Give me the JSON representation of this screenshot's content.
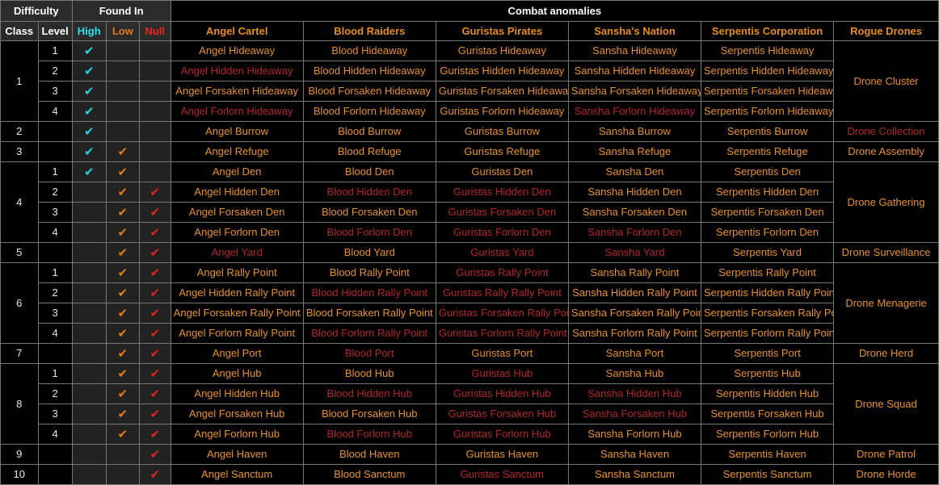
{
  "table": {
    "group_headers": [
      {
        "label": "Difficulty",
        "span": 2
      },
      {
        "label": "Found In",
        "span": 3
      },
      {
        "label": "Combat anomalies",
        "span": 6
      }
    ],
    "columns": [
      {
        "key": "class",
        "label": "Class"
      },
      {
        "key": "level",
        "label": "Level"
      },
      {
        "key": "high",
        "label": "High"
      },
      {
        "key": "low",
        "label": "Low"
      },
      {
        "key": "null",
        "label": "Null"
      },
      {
        "key": "angel",
        "label": "Angel Cartel"
      },
      {
        "key": "blood",
        "label": "Blood Raiders"
      },
      {
        "key": "guristas",
        "label": "Guristas Pirates"
      },
      {
        "key": "sansha",
        "label": "Sansha's Nation"
      },
      {
        "key": "serpentis",
        "label": "Serpentis Corporation"
      },
      {
        "key": "drones",
        "label": "Rogue Drones"
      }
    ],
    "check_glyph": "✔",
    "colors": {
      "high": "#25e6ec",
      "low": "#e07b19",
      "null": "#e8281c",
      "faction_header": "#e88e17",
      "text_orange": "#e8912a",
      "text_red": "#b4252a",
      "header_bg": "#2b2b2b",
      "cell_bg": "#000000",
      "foundin_bg": "#222222",
      "border": "#777777"
    },
    "rows": [
      {
        "class": "1",
        "class_span": 4,
        "level": "1",
        "high": true,
        "low": false,
        "null": false,
        "angel": {
          "t": "Angel Hideaway",
          "c": "o"
        },
        "blood": {
          "t": "Blood Hideaway",
          "c": "o"
        },
        "guristas": {
          "t": "Guristas Hideaway",
          "c": "o"
        },
        "sansha": {
          "t": "Sansha Hideaway",
          "c": "o"
        },
        "serpentis": {
          "t": "Serpentis Hideaway",
          "c": "o"
        },
        "drones": {
          "t": "Drone Cluster",
          "c": "o",
          "span": 4
        }
      },
      {
        "class": null,
        "level": "2",
        "high": true,
        "low": false,
        "null": false,
        "angel": {
          "t": "Angel Hidden Hideaway",
          "c": "r"
        },
        "blood": {
          "t": "Blood Hidden Hideaway",
          "c": "o"
        },
        "guristas": {
          "t": "Guristas Hidden Hideaway",
          "c": "o"
        },
        "sansha": {
          "t": "Sansha Hidden Hideaway",
          "c": "o"
        },
        "serpentis": {
          "t": "Serpentis Hidden Hideaway",
          "c": "o"
        },
        "drones": null
      },
      {
        "class": null,
        "level": "3",
        "high": true,
        "low": false,
        "null": false,
        "angel": {
          "t": "Angel Forsaken Hideaway",
          "c": "o"
        },
        "blood": {
          "t": "Blood Forsaken Hideaway",
          "c": "o"
        },
        "guristas": {
          "t": "Guristas Forsaken Hideaway",
          "c": "o"
        },
        "sansha": {
          "t": "Sansha Forsaken Hideaway",
          "c": "o"
        },
        "serpentis": {
          "t": "Serpentis Forsaken Hideaway",
          "c": "o"
        },
        "drones": null
      },
      {
        "class": null,
        "level": "4",
        "high": true,
        "low": false,
        "null": false,
        "angel": {
          "t": "Angel Forlorn Hideaway",
          "c": "r"
        },
        "blood": {
          "t": "Blood Forlorn Hideaway",
          "c": "o"
        },
        "guristas": {
          "t": "Guristas Forlorn Hideaway",
          "c": "o"
        },
        "sansha": {
          "t": "Sansha Forlorn Hideaway",
          "c": "r"
        },
        "serpentis": {
          "t": "Serpentis Forlorn Hideaway",
          "c": "o"
        },
        "drones": null
      },
      {
        "class": "2",
        "class_span": 1,
        "level": "",
        "high": true,
        "low": false,
        "null": false,
        "angel": {
          "t": "Angel Burrow",
          "c": "o"
        },
        "blood": {
          "t": "Blood Burrow",
          "c": "o"
        },
        "guristas": {
          "t": "Guristas Burrow",
          "c": "o"
        },
        "sansha": {
          "t": "Sansha Burrow",
          "c": "o"
        },
        "serpentis": {
          "t": "Serpentis Burrow",
          "c": "o"
        },
        "drones": {
          "t": "Drone Collection",
          "c": "r",
          "span": 1
        }
      },
      {
        "class": "3",
        "class_span": 1,
        "level": "",
        "high": true,
        "low": true,
        "null": false,
        "angel": {
          "t": "Angel Refuge",
          "c": "o"
        },
        "blood": {
          "t": "Blood Refuge",
          "c": "o"
        },
        "guristas": {
          "t": "Guristas Refuge",
          "c": "o"
        },
        "sansha": {
          "t": "Sansha Refuge",
          "c": "o"
        },
        "serpentis": {
          "t": "Serpentis Refuge",
          "c": "o"
        },
        "drones": {
          "t": "Drone Assembly",
          "c": "o",
          "span": 1
        }
      },
      {
        "class": "4",
        "class_span": 4,
        "level": "1",
        "high": true,
        "low": true,
        "null": false,
        "angel": {
          "t": "Angel Den",
          "c": "o"
        },
        "blood": {
          "t": "Blood Den",
          "c": "o"
        },
        "guristas": {
          "t": "Guristas Den",
          "c": "o"
        },
        "sansha": {
          "t": "Sansha Den",
          "c": "o"
        },
        "serpentis": {
          "t": "Serpentis Den",
          "c": "o"
        },
        "drones": {
          "t": "Drone Gathering",
          "c": "o",
          "span": 4
        }
      },
      {
        "class": null,
        "level": "2",
        "high": false,
        "low": true,
        "null": true,
        "angel": {
          "t": "Angel Hidden Den",
          "c": "o"
        },
        "blood": {
          "t": "Blood Hidden Den",
          "c": "r"
        },
        "guristas": {
          "t": "Guristas Hidden Den",
          "c": "r"
        },
        "sansha": {
          "t": "Sansha Hidden Den",
          "c": "o"
        },
        "serpentis": {
          "t": "Serpentis Hidden Den",
          "c": "o"
        },
        "drones": null
      },
      {
        "class": null,
        "level": "3",
        "high": false,
        "low": true,
        "null": true,
        "angel": {
          "t": "Angel Forsaken Den",
          "c": "o"
        },
        "blood": {
          "t": "Blood Forsaken Den",
          "c": "o"
        },
        "guristas": {
          "t": "Guristas Forsaken Den",
          "c": "r"
        },
        "sansha": {
          "t": "Sansha Forsaken Den",
          "c": "o"
        },
        "serpentis": {
          "t": "Serpentis Forsaken Den",
          "c": "o"
        },
        "drones": null
      },
      {
        "class": null,
        "level": "4",
        "high": false,
        "low": true,
        "null": true,
        "angel": {
          "t": "Angel Forlorn Den",
          "c": "o"
        },
        "blood": {
          "t": "Blood Forlorn Den",
          "c": "r"
        },
        "guristas": {
          "t": "Guristas Forlorn Den",
          "c": "r"
        },
        "sansha": {
          "t": "Sansha Forlorn Den",
          "c": "r"
        },
        "serpentis": {
          "t": "Serpentis Forlorn Den",
          "c": "o"
        },
        "drones": null
      },
      {
        "class": "5",
        "class_span": 1,
        "level": "",
        "high": false,
        "low": true,
        "null": true,
        "angel": {
          "t": "Angel Yard",
          "c": "r"
        },
        "blood": {
          "t": "Blood Yard",
          "c": "o"
        },
        "guristas": {
          "t": "Guristas Yard",
          "c": "r"
        },
        "sansha": {
          "t": "Sansha Yard",
          "c": "r"
        },
        "serpentis": {
          "t": "Serpentis Yard",
          "c": "o"
        },
        "drones": {
          "t": "Drone Surveillance",
          "c": "o",
          "span": 1
        }
      },
      {
        "class": "6",
        "class_span": 4,
        "level": "1",
        "high": false,
        "low": true,
        "null": true,
        "angel": {
          "t": "Angel Rally Point",
          "c": "o"
        },
        "blood": {
          "t": "Blood Rally Point",
          "c": "o"
        },
        "guristas": {
          "t": "Guristas Rally Point",
          "c": "r"
        },
        "sansha": {
          "t": "Sansha Rally Point",
          "c": "o"
        },
        "serpentis": {
          "t": "Serpentis Rally Point",
          "c": "o"
        },
        "drones": {
          "t": "Drone Menagerie",
          "c": "o",
          "span": 4
        }
      },
      {
        "class": null,
        "level": "2",
        "high": false,
        "low": true,
        "null": true,
        "angel": {
          "t": "Angel Hidden Rally Point",
          "c": "o"
        },
        "blood": {
          "t": "Blood Hidden Rally Point",
          "c": "r"
        },
        "guristas": {
          "t": "Guristas Rally Rally Point",
          "c": "r"
        },
        "sansha": {
          "t": "Sansha Hidden Rally Point",
          "c": "o"
        },
        "serpentis": {
          "t": "Serpentis Hidden Rally Point",
          "c": "o"
        },
        "drones": null
      },
      {
        "class": null,
        "level": "3",
        "high": false,
        "low": true,
        "null": true,
        "angel": {
          "t": "Angel Forsaken Rally Point",
          "c": "o"
        },
        "blood": {
          "t": "Blood Forsaken Rally Point",
          "c": "o"
        },
        "guristas": {
          "t": "Guristas Forsaken Rally Point",
          "c": "r"
        },
        "sansha": {
          "t": "Sansha Forsaken Rally Point",
          "c": "o"
        },
        "serpentis": {
          "t": "Serpentis Forsaken Rally Point",
          "c": "o"
        },
        "drones": null
      },
      {
        "class": null,
        "level": "4",
        "high": false,
        "low": true,
        "null": true,
        "angel": {
          "t": "Angel Forlorn Rally Point",
          "c": "o"
        },
        "blood": {
          "t": "Blood Forlorn Rally Point",
          "c": "r"
        },
        "guristas": {
          "t": "Guristas Forlorn Rally Point",
          "c": "r"
        },
        "sansha": {
          "t": "Sansha Forlorn Rally Point",
          "c": "o"
        },
        "serpentis": {
          "t": "Serpentis Forlorn Rally Point",
          "c": "o"
        },
        "drones": null
      },
      {
        "class": "7",
        "class_span": 1,
        "level": "",
        "high": false,
        "low": true,
        "null": true,
        "angel": {
          "t": "Angel Port",
          "c": "o"
        },
        "blood": {
          "t": "Blood Port",
          "c": "r"
        },
        "guristas": {
          "t": "Guristas Port",
          "c": "o"
        },
        "sansha": {
          "t": "Sansha Port",
          "c": "o"
        },
        "serpentis": {
          "t": "Serpentis Port",
          "c": "o"
        },
        "drones": {
          "t": "Drone Herd",
          "c": "o",
          "span": 1
        }
      },
      {
        "class": "8",
        "class_span": 4,
        "level": "1",
        "high": false,
        "low": true,
        "null": true,
        "angel": {
          "t": "Angel Hub",
          "c": "o"
        },
        "blood": {
          "t": "Blood Hub",
          "c": "o"
        },
        "guristas": {
          "t": "Guristas Hub",
          "c": "r"
        },
        "sansha": {
          "t": "Sansha Hub",
          "c": "o"
        },
        "serpentis": {
          "t": "Serpentis Hub",
          "c": "o"
        },
        "drones": {
          "t": "Drone Squad",
          "c": "o",
          "span": 4
        }
      },
      {
        "class": null,
        "level": "2",
        "high": false,
        "low": true,
        "null": true,
        "angel": {
          "t": "Angel Hidden Hub",
          "c": "o"
        },
        "blood": {
          "t": "Blood Hidden Hub",
          "c": "r"
        },
        "guristas": {
          "t": "Guristas Hidden Hub",
          "c": "r"
        },
        "sansha": {
          "t": "Sansha Hidden Hub",
          "c": "r"
        },
        "serpentis": {
          "t": "Serpentis Hidden Hub",
          "c": "o"
        },
        "drones": null
      },
      {
        "class": null,
        "level": "3",
        "high": false,
        "low": true,
        "null": true,
        "angel": {
          "t": "Angel Forsaken Hub",
          "c": "o"
        },
        "blood": {
          "t": "Blood Forsaken Hub",
          "c": "o"
        },
        "guristas": {
          "t": "Guristas Forsaken Hub",
          "c": "r"
        },
        "sansha": {
          "t": "Sansha Forsaken Hub",
          "c": "r"
        },
        "serpentis": {
          "t": "Serpentis Forsaken Hub",
          "c": "o"
        },
        "drones": null
      },
      {
        "class": null,
        "level": "4",
        "high": false,
        "low": true,
        "null": true,
        "angel": {
          "t": "Angel Forlorn Hub",
          "c": "o"
        },
        "blood": {
          "t": "Blood Forlorn Hub",
          "c": "r"
        },
        "guristas": {
          "t": "Guristas Forlorn Hub",
          "c": "r"
        },
        "sansha": {
          "t": "Sansha Forlorn Hub",
          "c": "o"
        },
        "serpentis": {
          "t": "Serpentis Forlorn Hub",
          "c": "o"
        },
        "drones": null
      },
      {
        "class": "9",
        "class_span": 1,
        "level": "",
        "high": false,
        "low": false,
        "null": true,
        "angel": {
          "t": "Angel Haven",
          "c": "o"
        },
        "blood": {
          "t": "Blood Haven",
          "c": "o"
        },
        "guristas": {
          "t": "Guristas Haven",
          "c": "o"
        },
        "sansha": {
          "t": "Sansha Haven",
          "c": "o"
        },
        "serpentis": {
          "t": "Serpentis Haven",
          "c": "o"
        },
        "drones": {
          "t": "Drone Patrol",
          "c": "o",
          "span": 1
        }
      },
      {
        "class": "10",
        "class_span": 1,
        "level": "",
        "high": false,
        "low": false,
        "null": true,
        "angel": {
          "t": "Angel Sanctum",
          "c": "o"
        },
        "blood": {
          "t": "Blood Sanctum",
          "c": "o"
        },
        "guristas": {
          "t": "Guristas Sanctum",
          "c": "r"
        },
        "sansha": {
          "t": "Sansha Sanctum",
          "c": "o"
        },
        "serpentis": {
          "t": "Serpentis Sanctum",
          "c": "o"
        },
        "drones": {
          "t": "Drone Horde",
          "c": "o",
          "span": 1
        }
      }
    ]
  }
}
